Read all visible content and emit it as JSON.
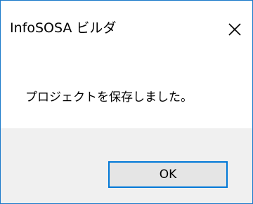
{
  "window": {
    "title": "InfoSOSA ビルダ",
    "close_icon": "close-icon"
  },
  "dialog": {
    "message": "プロジェクトを保存しました。"
  },
  "buttons": {
    "ok_label": "OK"
  },
  "colors": {
    "window_border": "#1979ca",
    "button_focus_border": "#0078d7",
    "footer_background": "#f0f0f0",
    "button_background": "#e5e5e5"
  }
}
